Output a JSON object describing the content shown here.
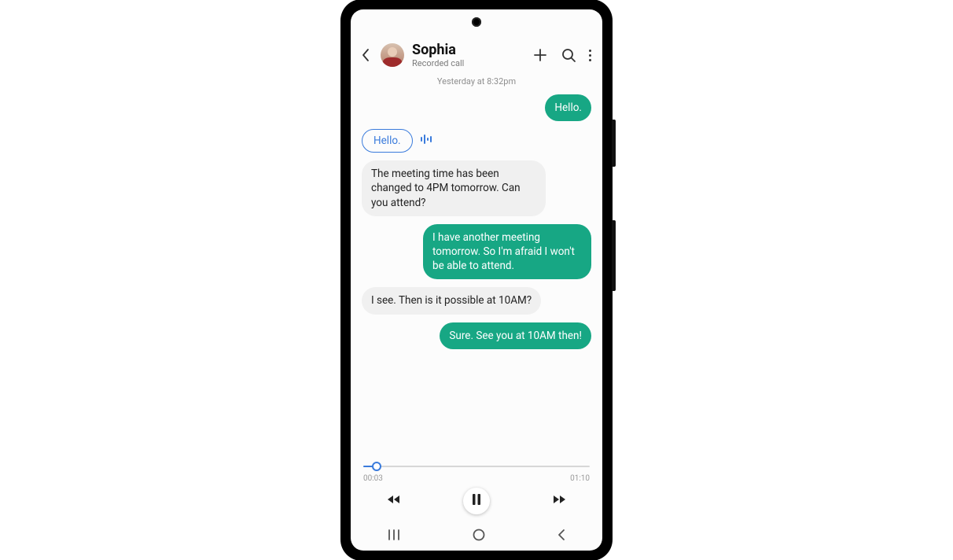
{
  "colors": {
    "accent": "#17a784",
    "link": "#3a7bdc"
  },
  "header": {
    "contact_name": "Sophia",
    "subtitle": "Recorded call",
    "icons": {
      "back": "chevron-left-icon",
      "add": "plus-icon",
      "search": "search-icon",
      "more": "more-vertical-icon"
    }
  },
  "timestamp": "Yesterday at 8:32pm",
  "messages": [
    {
      "side": "sent",
      "text": "Hello."
    },
    {
      "side": "recv_pill",
      "text": "Hello.",
      "has_waveform": true
    },
    {
      "side": "recv",
      "text": "The meeting time has been changed to 4PM tomorrow. Can you attend?"
    },
    {
      "side": "sent",
      "text": "I have another meeting tomorrow. So I'm afraid I won't be able to attend."
    },
    {
      "side": "recv",
      "text": "I see. Then is it possible at 10AM?"
    },
    {
      "side": "sent",
      "text": "Sure. See you at 10AM then!"
    }
  ],
  "player": {
    "elapsed": "00:03",
    "total": "01:10",
    "progress_percent": 6,
    "state": "paused",
    "controls": {
      "rewind": "rewind-icon",
      "playpause": "pause-icon",
      "forward": "fast-forward-icon"
    }
  },
  "navbar": {
    "recents": "recents-icon",
    "home": "home-icon",
    "back": "back-icon"
  }
}
